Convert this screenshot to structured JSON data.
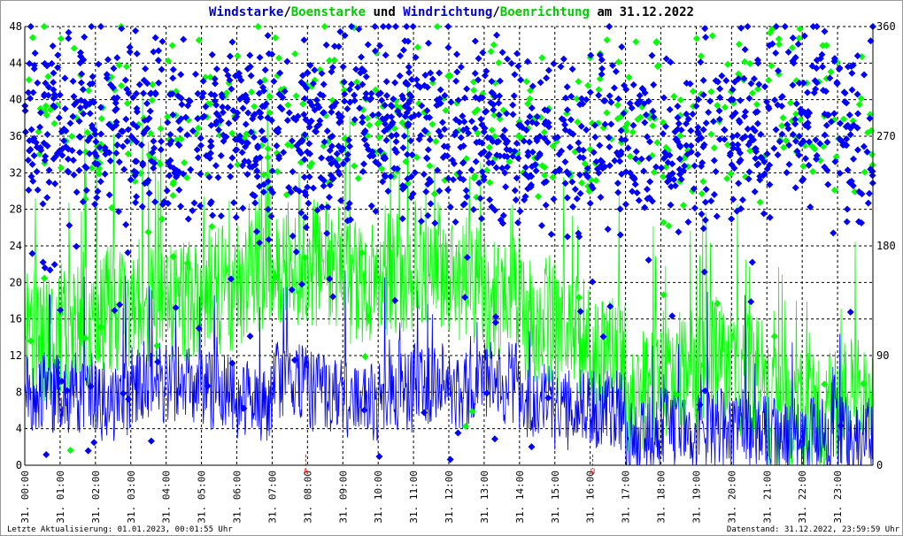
{
  "chart_data": {
    "type": "line",
    "title_parts": [
      {
        "text": "Windstarke",
        "color": "#0000cc"
      },
      {
        "text": "/",
        "color": "#000000"
      },
      {
        "text": "Boenstarke",
        "color": "#00cc00"
      },
      {
        "text": " und ",
        "color": "#000000"
      },
      {
        "text": "Windrichtung",
        "color": "#0000cc"
      },
      {
        "text": "/",
        "color": "#000000"
      },
      {
        "text": "Boenrichtung",
        "color": "#00cc00"
      },
      {
        "text": " am 31.12.2022",
        "color": "#000000"
      }
    ],
    "x_tick_labels": [
      "31. 00:00",
      "31. 01:00",
      "31. 02:00",
      "31. 03:00",
      "31. 04:00",
      "31. 05:00",
      "31. 06:00",
      "31. 07:00",
      "31. 08:00",
      "31. 09:00",
      "31. 10:00",
      "31. 11:00",
      "31. 12:00",
      "31. 13:00",
      "31. 14:00",
      "31. 15:00",
      "31. 16:00",
      "31. 17:00",
      "31. 18:00",
      "31. 19:00",
      "31. 20:00",
      "31. 21:00",
      "31. 22:00",
      "31. 23:00"
    ],
    "xlim_hours": [
      0,
      24
    ],
    "y_left": {
      "ylim": [
        0,
        48
      ],
      "ticks": [
        "0",
        "4",
        "8",
        "12",
        "16",
        "20",
        "24",
        "28",
        "32",
        "36",
        "40",
        "44",
        "48"
      ]
    },
    "y_right": {
      "ylim": [
        0,
        360
      ],
      "ticks": [
        "0",
        "90",
        "180",
        "270",
        "360"
      ]
    },
    "grid": true,
    "markers": [
      {
        "label": "A",
        "hour": 7.95,
        "color": "#ff0000"
      },
      {
        "label": "U",
        "hour": 16.07,
        "color": "#ff0000"
      }
    ],
    "series": [
      {
        "name": "Windstarke",
        "kind": "line",
        "axis": "left",
        "color": "#0000ff",
        "hourly_mean": [
          8,
          8,
          7,
          9,
          9,
          8,
          7,
          9,
          8,
          7,
          8,
          9,
          8,
          9,
          7,
          6,
          6,
          3,
          4,
          4,
          4,
          3,
          3,
          3
        ]
      },
      {
        "name": "Boenstarke",
        "kind": "line",
        "axis": "left",
        "color": "#00ff00",
        "hourly_mean": [
          14,
          15,
          17,
          18,
          18,
          19,
          20,
          22,
          22,
          20,
          21,
          22,
          20,
          18,
          16,
          14,
          12,
          8,
          10,
          11,
          10,
          6,
          6,
          7
        ]
      },
      {
        "name": "Windrichtung",
        "kind": "scatter",
        "axis": "right",
        "color": "#0000ff",
        "hourly_mean": [
          285,
          280,
          280,
          275,
          270,
          275,
          275,
          270,
          270,
          280,
          285,
          275,
          270,
          270,
          265,
          260,
          270,
          265,
          260,
          270,
          280,
          295,
          285,
          270
        ]
      },
      {
        "name": "Boenrichtung",
        "kind": "scatter",
        "axis": "right",
        "color": "#00ff00",
        "hourly_mean": [
          300,
          285,
          285,
          270,
          280,
          285,
          285,
          285,
          290,
          290,
          285,
          280,
          275,
          280,
          275,
          265,
          285,
          280,
          270,
          270,
          290,
          300,
          280,
          275
        ]
      }
    ]
  },
  "footer": {
    "left": "Letzte Aktualisierung: 01.01.2023, 00:01:55 Uhr",
    "right": "Datenstand: 31.12.2022, 23:59:59 Uhr"
  }
}
